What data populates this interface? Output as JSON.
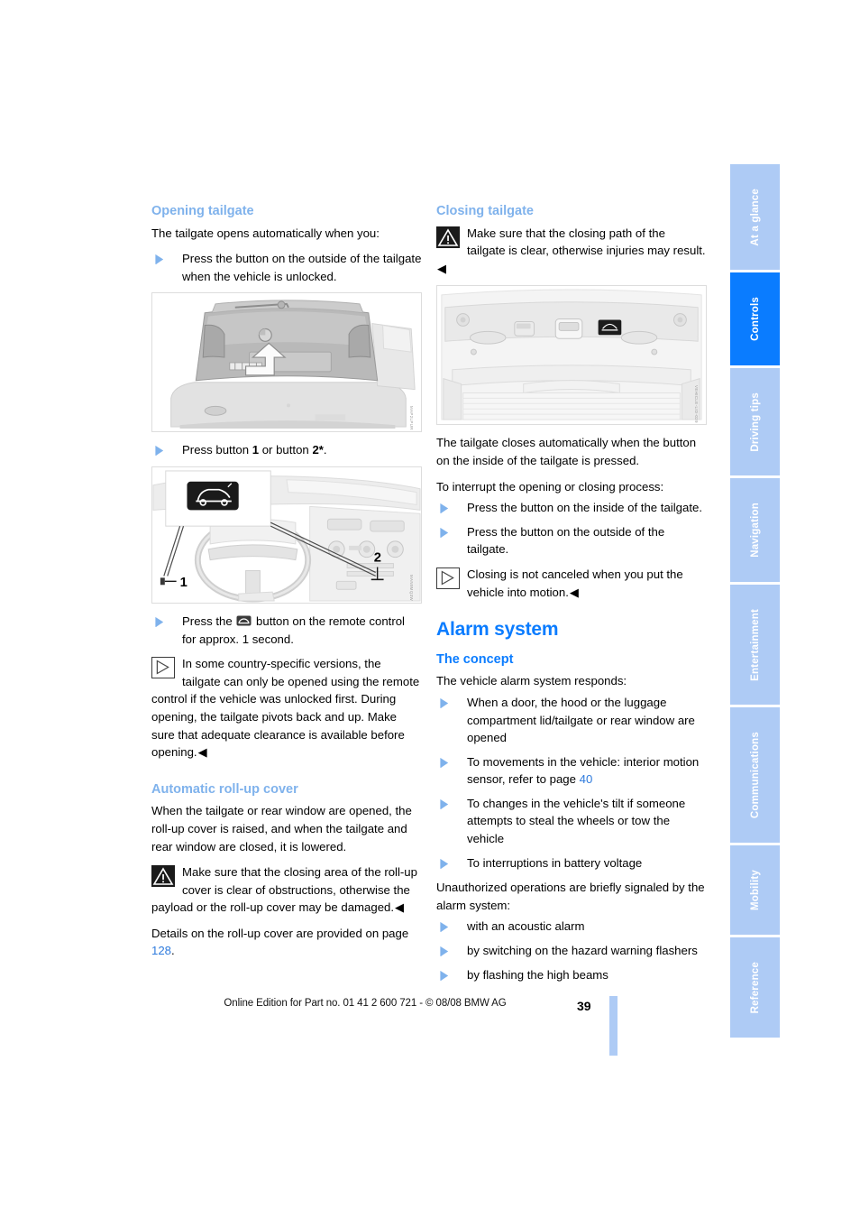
{
  "page": {
    "number": "39",
    "footer_text": "Online Edition for Part no. 01 41 2 600 721 - © 08/08 BMW AG"
  },
  "tabs": [
    {
      "label": "At a glance",
      "active": false
    },
    {
      "label": "Controls",
      "active": true
    },
    {
      "label": "Driving tips",
      "active": false
    },
    {
      "label": "Navigation",
      "active": false
    },
    {
      "label": "Entertainment",
      "active": false
    },
    {
      "label": "Communications",
      "active": false
    },
    {
      "label": "Mobility",
      "active": false
    },
    {
      "label": "Reference",
      "active": false
    }
  ],
  "left_column": {
    "heading_opening": "Opening tailgate",
    "intro": "The tailgate opens automatically when you:",
    "bullets_open": [
      "Press the button on the outside of the tailgate when the vehicle is unlocked."
    ],
    "figure_tailgate_exterior": {
      "alt": "Rear view of vehicle tailgate with arrow pointing at release button",
      "code": "MAP2LPUR"
    },
    "bullet_buttons_pre": "Press button ",
    "bullet_buttons_b1": "1",
    "bullet_buttons_mid": " or button ",
    "bullet_buttons_b2": "2*",
    "bullet_buttons_post": ".",
    "figure_interior": {
      "alt": "Vehicle interior showing dashboard button 1 and console button 2",
      "label_1": "1",
      "label_2": "2",
      "code": "MAN9MQ3W"
    },
    "bullet_remote_pre": "Press the ",
    "bullet_remote_post": " button on the remote control for approx. 1 second.",
    "note_remote": "In some country-specific versions, the tailgate can only be opened using the remote control if the vehicle was unlocked first. During opening, the tailgate pivots back and up. Make sure that adequate clearance is available before opening.",
    "heading_rollup": "Automatic roll-up cover",
    "rollup_body": "When the tailgate or rear window are opened, the roll-up cover is raised, and when the tailgate and rear window are closed, it is lowered.",
    "warning_rollup": "Make sure that the closing area of the roll-up cover is clear of obstructions, otherwise the payload or the roll-up cover may be damaged.",
    "details_pre": "Details on the roll-up cover are provided on page ",
    "details_page": "128",
    "details_post": "."
  },
  "right_column": {
    "heading_closing": "Closing tailgate",
    "warning_closing": "Make sure that the closing path of the tailgate is clear, otherwise injuries may result.",
    "figure_tailgate_interior": {
      "alt": "Inside view of open tailgate showing close button",
      "code": "VEHICLE-LID-029"
    },
    "closes_body": "The tailgate closes automatically when the button on the inside of the tailgate is pressed.",
    "interrupt_intro": "To interrupt the opening or closing process:",
    "bullets_interrupt": [
      "Press the button on the inside of the tailgate.",
      "Press the button on the outside of the tailgate."
    ],
    "note_closing": "Closing is not canceled when you put the vehicle into motion.",
    "heading_alarm": "Alarm system",
    "heading_concept": "The concept",
    "concept_intro": "The vehicle alarm system responds:",
    "bullets_responds": [
      {
        "text": "When a door, the hood or the luggage compartment lid/tailgate or rear window are opened",
        "link": ""
      },
      {
        "text_pre": "To movements in the vehicle: interior motion sensor, refer to page ",
        "link": "40",
        "text_post": ""
      },
      {
        "text": "To changes in the vehicle's tilt if someone attempts to steal the wheels or tow the vehicle",
        "link": ""
      },
      {
        "text": "To interruptions in battery voltage",
        "link": ""
      }
    ],
    "unauthorized_intro": "Unauthorized operations are briefly signaled by the alarm system:",
    "bullets_signals": [
      "with an acoustic alarm",
      "by switching on the hazard warning flashers",
      "by flashing the high beams"
    ]
  },
  "colors": {
    "accent_blue": "#0a7cff",
    "light_blue": "#7fb2ec",
    "tab_inactive": "#aecbf5",
    "link_blue": "#2f7bdd"
  }
}
